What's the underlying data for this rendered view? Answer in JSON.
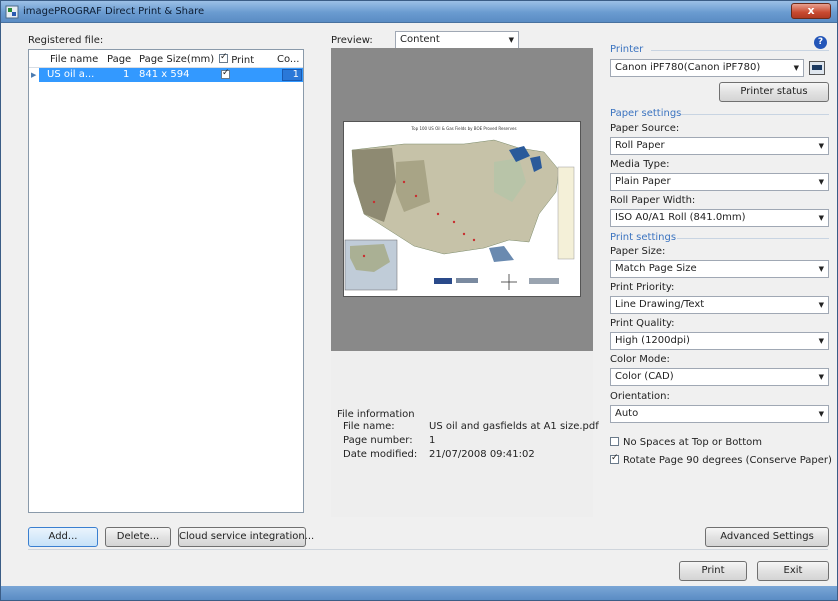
{
  "window": {
    "title": "imagePROGRAF Direct Print & Share",
    "close_label": "x"
  },
  "registered": {
    "label": "Registered file:",
    "columns": [
      "File name",
      "Page",
      "Page Size(mm)",
      "Print",
      "Co..."
    ],
    "rows": [
      {
        "name": "US oil a...",
        "page": "1",
        "size": "841 x 594",
        "print": true,
        "copies": "1"
      }
    ],
    "buttons": {
      "add": "Add...",
      "delete": "Delete...",
      "cloud": "Cloud service integration..."
    }
  },
  "preview": {
    "label": "Preview:",
    "mode": "Content",
    "map_title": "Top 100 US Oil & Gas Fields by BOE Proved Reserves"
  },
  "file_info": {
    "title": "File information",
    "name_label": "File name:",
    "name_value": "US oil and gasfields at A1 size.pdf",
    "page_label": "Page number:",
    "page_value": "1",
    "date_label": "Date modified:",
    "date_value": "21/07/2008 09:41:02"
  },
  "printer": {
    "section": "Printer",
    "selected": "Canon iPF780(Canon iPF780)",
    "status_button": "Printer status"
  },
  "paper_settings": {
    "section": "Paper settings",
    "source_label": "Paper Source:",
    "source_value": "Roll Paper",
    "media_label": "Media Type:",
    "media_value": "Plain Paper",
    "width_label": "Roll Paper Width:",
    "width_value": "ISO A0/A1 Roll (841.0mm)"
  },
  "print_settings": {
    "section": "Print settings",
    "size_label": "Paper Size:",
    "size_value": "Match Page Size",
    "priority_label": "Print Priority:",
    "priority_value": "Line Drawing/Text",
    "quality_label": "Print Quality:",
    "quality_value": "High (1200dpi)",
    "color_label": "Color Mode:",
    "color_value": "Color (CAD)",
    "orientation_label": "Orientation:",
    "orientation_value": "Auto",
    "no_spaces_label": "No Spaces at Top or Bottom",
    "no_spaces_checked": false,
    "rotate_label": "Rotate Page 90 degrees (Conserve Paper)",
    "rotate_checked": true,
    "advanced_button": "Advanced Settings"
  },
  "footer": {
    "print_button": "Print",
    "exit_button": "Exit"
  },
  "colors": {
    "selection": "#3399ff",
    "section_title": "#3c74c0",
    "preview_bg": "#898989"
  }
}
